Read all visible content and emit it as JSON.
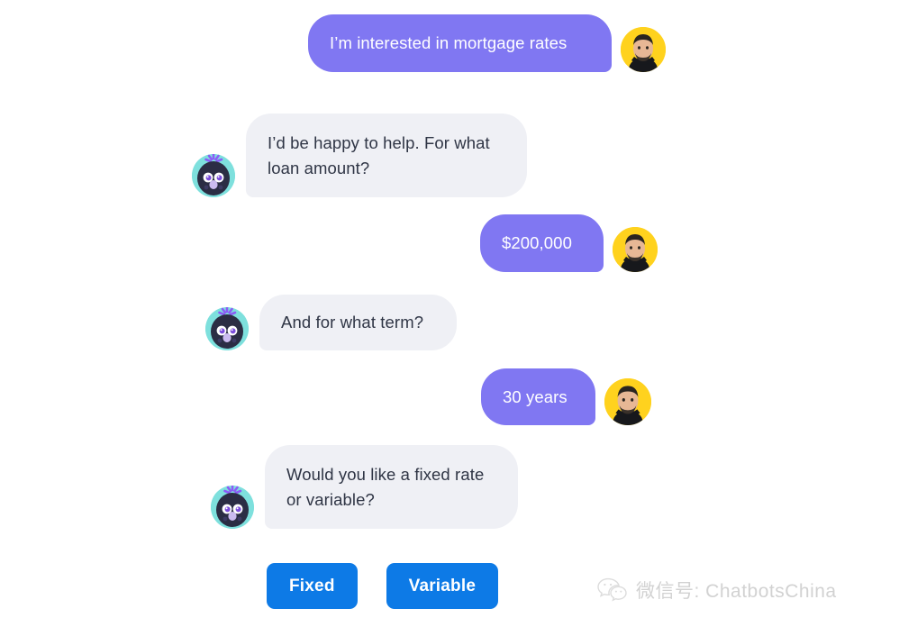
{
  "theme": {
    "background": "#ffffff",
    "user_bubble_bg": "#8077f2",
    "user_bubble_text": "#ffffff",
    "bot_bubble_bg": "#eff0f5",
    "bot_bubble_text": "#2f3545",
    "button_bg": "#0d7ae6",
    "button_text": "#ffffff",
    "user_avatar_bg": "#ffd21e",
    "bot_avatar_bg": "#7ee0dd",
    "watermark_color": "#d2d2d2"
  },
  "conversation": {
    "messages": [
      {
        "id": "msg-1",
        "sender": "user",
        "text": "I’m interested in mortgage rates",
        "avatar_icon": "user-photo-avatar"
      },
      {
        "id": "msg-2",
        "sender": "bot",
        "text": "I’d be happy to help. For what\nloan amount?",
        "avatar_icon": "bot-penguin-avatar"
      },
      {
        "id": "msg-3",
        "sender": "user",
        "text": "$200,000",
        "avatar_icon": "user-photo-avatar"
      },
      {
        "id": "msg-4",
        "sender": "bot",
        "text": "And for what term?",
        "avatar_icon": "bot-penguin-avatar"
      },
      {
        "id": "msg-5",
        "sender": "user",
        "text": "30 years",
        "avatar_icon": "user-photo-avatar"
      },
      {
        "id": "msg-6",
        "sender": "bot",
        "text": "Would you like a fixed rate\nor variable?",
        "avatar_icon": "bot-penguin-avatar"
      }
    ]
  },
  "quick_replies": {
    "options": [
      {
        "id": "qr-fixed",
        "label": "Fixed"
      },
      {
        "id": "qr-variable",
        "label": "Variable"
      }
    ]
  },
  "watermark": {
    "icon": "wechat-icon",
    "text": "微信号: ChatbotsChina"
  }
}
